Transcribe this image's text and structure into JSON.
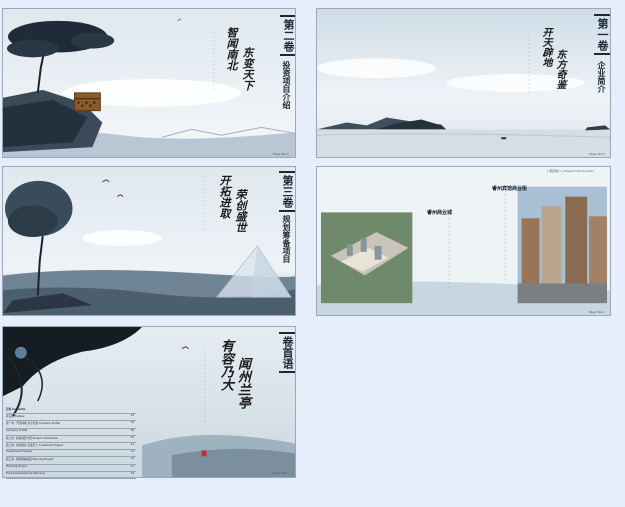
{
  "panels": [
    {
      "id": "vol2",
      "vertical_title": "第二卷",
      "subtitle": "投资项目介绍",
      "calligraphy_a": "智闻南北",
      "calligraphy_b": "东变天下",
      "page_label": "Page Wuxi"
    },
    {
      "id": "vol1",
      "vertical_title": "第一卷",
      "subtitle": "企业简介",
      "calligraphy_a": "开天辟地",
      "calligraphy_b": "东方奇鉴",
      "page_label": "Page Wuxi"
    },
    {
      "id": "vol3",
      "vertical_title": "第三卷",
      "subtitle": "规划筹备项目",
      "calligraphy_a": "开拓进取",
      "calligraphy_b": "荣创盛世",
      "page_label": "Page Wuxi"
    },
    {
      "id": "project",
      "header_label": "[ 项目简介 ] Project Introduction",
      "label_left": "睿州商业城",
      "label_right": "睿州宾馆商业街",
      "page_label": "Page Wuxi"
    },
    {
      "id": "preface",
      "vertical_title": "卷首语",
      "calligraphy_a": "有容乃大",
      "calligraphy_b": "闻州兰亭",
      "page_label": "Page Wuxi",
      "toc_header": "目录 Contents",
      "toc": [
        {
          "text": "卷首语 Preface",
          "page": "01"
        },
        {
          "text": "第一卷 · 开天辟地 东方奇鉴 Company Profile",
          "page": "03"
        },
        {
          "text": "Company Profile",
          "page": "05"
        },
        {
          "text": "第二卷 · 投资项目介绍 Project Introduction",
          "page": "07"
        },
        {
          "text": "第二卷 · 智闻南北 东变天下 Investment Project",
          "page": "11"
        },
        {
          "text": "Investment Projects",
          "page": "13"
        },
        {
          "text": "第三卷 · 规划筹备项目 Planning Project",
          "page": "15"
        },
        {
          "text": "Planning Project",
          "page": "17"
        },
        {
          "text": "Future Development Planning",
          "page": "19"
        }
      ]
    }
  ]
}
